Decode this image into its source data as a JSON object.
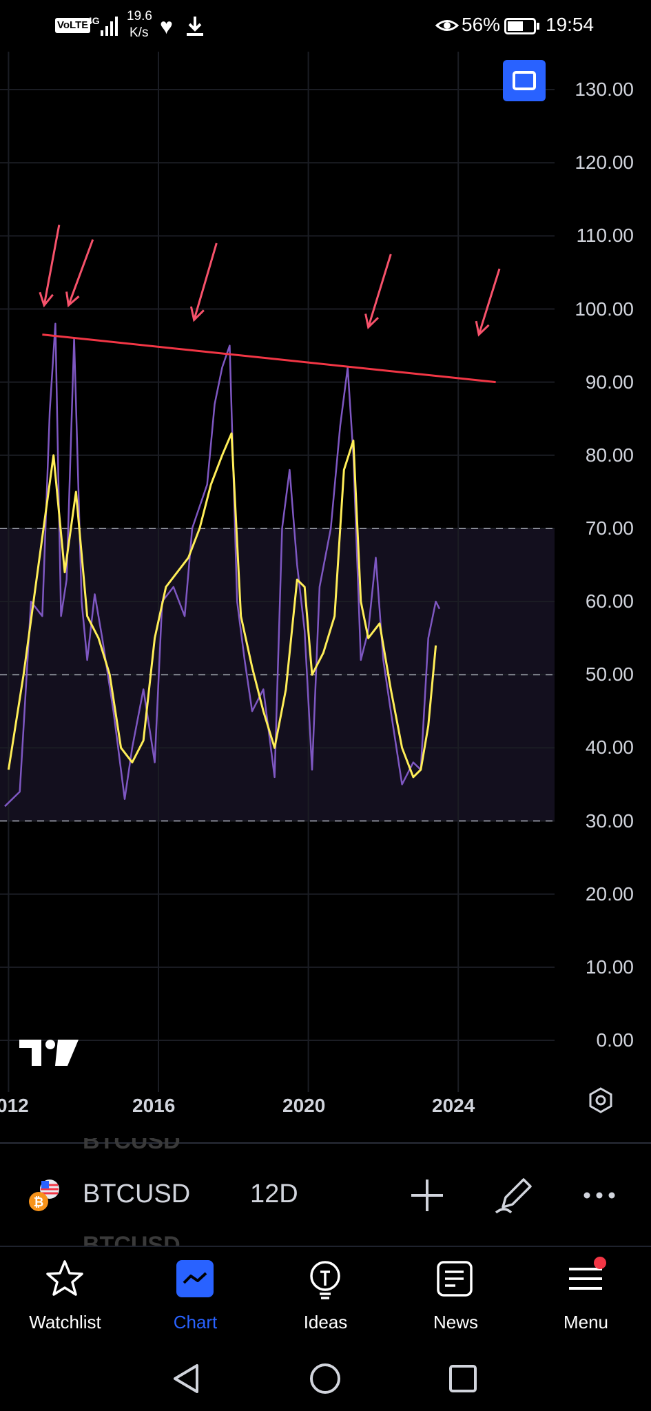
{
  "status_bar": {
    "volte": "VoLTE",
    "network": "4G",
    "speed_value": "19.6",
    "speed_unit": "K/s",
    "battery_percent": "56%",
    "time": "19:54"
  },
  "chart": {
    "y_axis_labels": [
      "130.00",
      "120.00",
      "110.00",
      "100.00",
      "90.00",
      "80.00",
      "70.00",
      "60.00",
      "50.00",
      "40.00",
      "30.00",
      "20.00",
      "10.00",
      "0.00"
    ],
    "x_axis_labels": [
      "012",
      "2016",
      "2020",
      "2024"
    ],
    "colors": {
      "rsi_line": "#7e57c2",
      "ma_line": "#ffee58",
      "trendline": "#f23645",
      "arrows": "#f7526b",
      "band": "#130f1e"
    },
    "bands": {
      "upper": 70,
      "middle": 50,
      "lower": 30
    }
  },
  "chart_data": {
    "type": "line",
    "y_axis_range": [
      0,
      130
    ],
    "series": [
      {
        "values_x_year": [
          2011.9,
          2012.3,
          2012.6,
          2012.9,
          2013.1,
          2013.25,
          2013.4,
          2013.55,
          2013.75,
          2013.95,
          2014.1,
          2014.3,
          2014.5,
          2014.8,
          2015.1,
          2015.3,
          2015.6,
          2015.9,
          2016.1,
          2016.4,
          2016.7,
          2016.9,
          2017.1,
          2017.3,
          2017.5,
          2017.7,
          2017.9,
          2018.1,
          2018.3,
          2018.5,
          2018.8,
          2019.1,
          2019.3,
          2019.5,
          2019.7,
          2019.9,
          2020.1,
          2020.3,
          2020.6,
          2020.85,
          2021.05,
          2021.2,
          2021.4,
          2021.6,
          2021.8,
          2022.0,
          2022.2,
          2022.5,
          2022.8,
          2023.0,
          2023.2,
          2023.4,
          2023.5
        ],
        "values_rsi": [
          32,
          34,
          60,
          58,
          86,
          98,
          58,
          63,
          96,
          60,
          52,
          61,
          55,
          45,
          33,
          40,
          48,
          38,
          60,
          62,
          58,
          70,
          73,
          76,
          87,
          92,
          95,
          60,
          52,
          45,
          48,
          36,
          70,
          78,
          65,
          56,
          37,
          62,
          70,
          84,
          92,
          80,
          52,
          56,
          66,
          52,
          45,
          35,
          38,
          37,
          55,
          60,
          59
        ]
      },
      {
        "values_x_year": [
          2012.0,
          2012.4,
          2012.8,
          2013.2,
          2013.5,
          2013.8,
          2014.1,
          2014.4,
          2014.7,
          2015.0,
          2015.3,
          2015.6,
          2015.9,
          2016.2,
          2016.5,
          2016.8,
          2017.1,
          2017.4,
          2017.7,
          2017.95,
          2018.2,
          2018.5,
          2018.8,
          2019.1,
          2019.4,
          2019.7,
          2019.9,
          2020.1,
          2020.4,
          2020.7,
          2020.95,
          2021.2,
          2021.4,
          2021.6,
          2021.9,
          2022.2,
          2022.5,
          2022.8,
          2023.0,
          2023.2,
          2023.4
        ],
        "values_ma": [
          37,
          50,
          65,
          80,
          64,
          75,
          58,
          55,
          50,
          40,
          38,
          41,
          55,
          62,
          64,
          66,
          70,
          76,
          80,
          83,
          58,
          51,
          45,
          40,
          48,
          63,
          62,
          50,
          53,
          58,
          78,
          82,
          60,
          55,
          57,
          48,
          40,
          36,
          37,
          43,
          54
        ]
      }
    ],
    "trendline": {
      "from": [
        2012.9,
        96.5
      ],
      "to": [
        2025.0,
        90.0
      ]
    },
    "horizontal_levels": [
      70,
      50,
      30
    ]
  },
  "symbol_bar": {
    "symbol": "BTCUSD",
    "interval": "12D",
    "ghost_above": "BTCUSD",
    "ghost_below": "BTCUSD"
  },
  "bottom_nav": {
    "items": [
      {
        "label": "Watchlist",
        "icon": "star-icon"
      },
      {
        "label": "Chart",
        "icon": "chart-icon"
      },
      {
        "label": "Ideas",
        "icon": "lightbulb-icon"
      },
      {
        "label": "News",
        "icon": "newspaper-icon"
      },
      {
        "label": "Menu",
        "icon": "hamburger-icon"
      }
    ]
  }
}
